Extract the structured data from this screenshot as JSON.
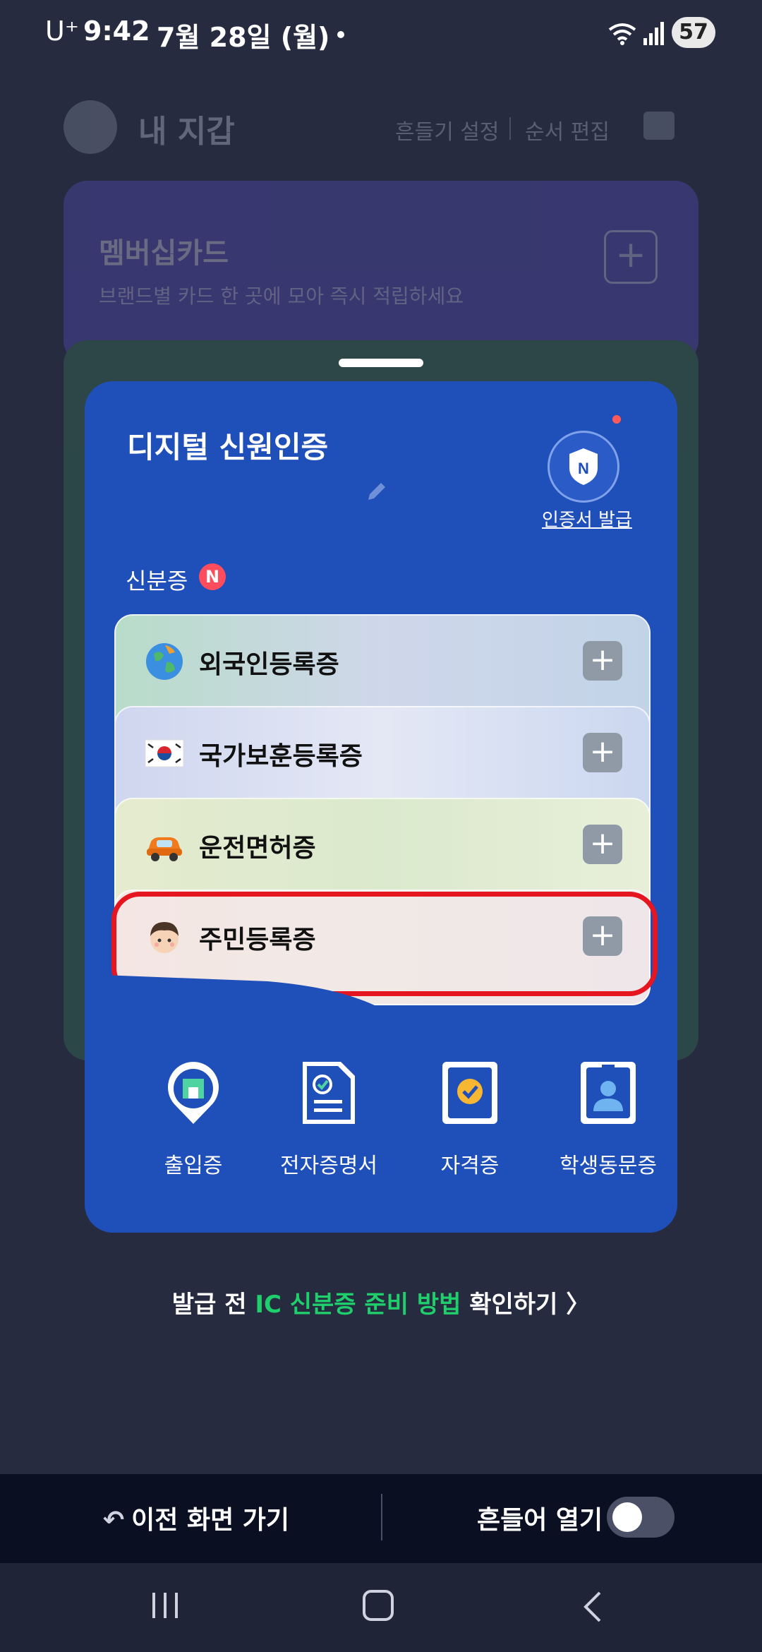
{
  "status_bar": {
    "carrier": "U⁺",
    "time": "9:42",
    "date": "7월 28일 (월)",
    "battery": "57"
  },
  "wallet": {
    "title": "내 지갑",
    "shake_setting": "흔들기 설정",
    "order_edit": "순서 편집"
  },
  "membership": {
    "title": "멤버십카드",
    "description": "브랜드별 카드 한 곳에 모아 즉시 적립하세요",
    "add_symbol": "+"
  },
  "digital_id": {
    "title": "디지털 신원인증",
    "cert_issue": "인증서 발급",
    "section_label": "신분증",
    "new_badge": "N",
    "cards": [
      {
        "label": "외국인등록증",
        "icon": "globe-icon",
        "add": "+"
      },
      {
        "label": "국가보훈등록증",
        "icon": "korea-flag-icon",
        "add": "+"
      },
      {
        "label": "운전면허증",
        "icon": "car-icon",
        "add": "+"
      },
      {
        "label": "주민등록증",
        "icon": "person-face-icon",
        "add": "+"
      }
    ],
    "quick_items": [
      {
        "label": "출입증",
        "icon": "building-pin-icon"
      },
      {
        "label": "전자증명서",
        "icon": "document-check-icon"
      },
      {
        "label": "자격증",
        "icon": "badge-certificate-icon"
      },
      {
        "label": "학생동문증",
        "icon": "student-id-icon"
      }
    ]
  },
  "guide": {
    "prefix": "발급 전 ",
    "highlight": "IC 신분증 준비 방법",
    "suffix": " 확인하기 ",
    "chevron": "〉"
  },
  "bottom_bar": {
    "back_label": "이전 화면 가기",
    "shake_open_label": "흔들어 열기",
    "shake_open_on": false
  },
  "colors": {
    "background": "#262b40",
    "main_card": "#1f4fb8",
    "highlight_border": "#e51620",
    "guide_highlight": "#1fcf6b"
  }
}
